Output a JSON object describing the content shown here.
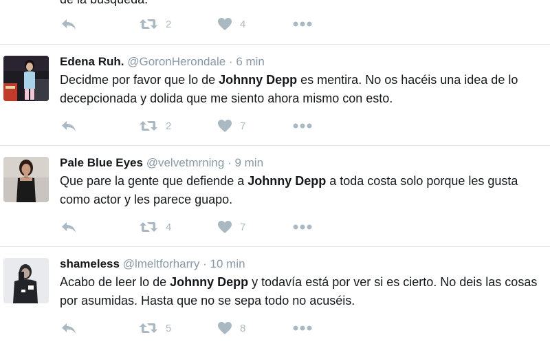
{
  "colors": {
    "divider": "#e1e8ed",
    "muted": "#8899a6",
    "icon": "#aab8c2",
    "text": "#14171a"
  },
  "top_partial": {
    "text_fragment": "de la búsqueda.",
    "retweets": "2",
    "likes": "4"
  },
  "tweets": [
    {
      "name": "Edena Ruh.",
      "handle": "@GoronHerondale",
      "sep": " · ",
      "time": "6 min",
      "text_before": "Decidme por favor que lo de ",
      "text_bold": "Johnny Depp",
      "text_after": " es mentira. No os hacéis una idea de lo decepcionada y dolida que me siento ahora mismo con esto.",
      "retweets": "2",
      "likes": "7"
    },
    {
      "name": "Pale Blue Eyes",
      "handle": "@velvetmrning",
      "sep": " · ",
      "time": "9 min",
      "text_before": "Que pare la gente que defiende a ",
      "text_bold": "Johnny Depp",
      "text_after": " a toda costa solo porque les gusta como actor y les parece guapo.",
      "retweets": "4",
      "likes": "7"
    },
    {
      "name": "shameless",
      "handle": "@lmeltforharry",
      "sep": " · ",
      "time": "10 min",
      "text_before": "Acabo de leer lo de ",
      "text_bold": "Johnny Depp",
      "text_after": " y todavía está por ver si es cierto. No deis las cosas por asumidas. Hasta que no se sepa todo no acuséis.",
      "retweets": "5",
      "likes": "8"
    }
  ],
  "icons": {
    "reply": "reply-icon",
    "retweet": "retweet-icon",
    "like": "heart-icon",
    "more": "more-dots-icon"
  }
}
